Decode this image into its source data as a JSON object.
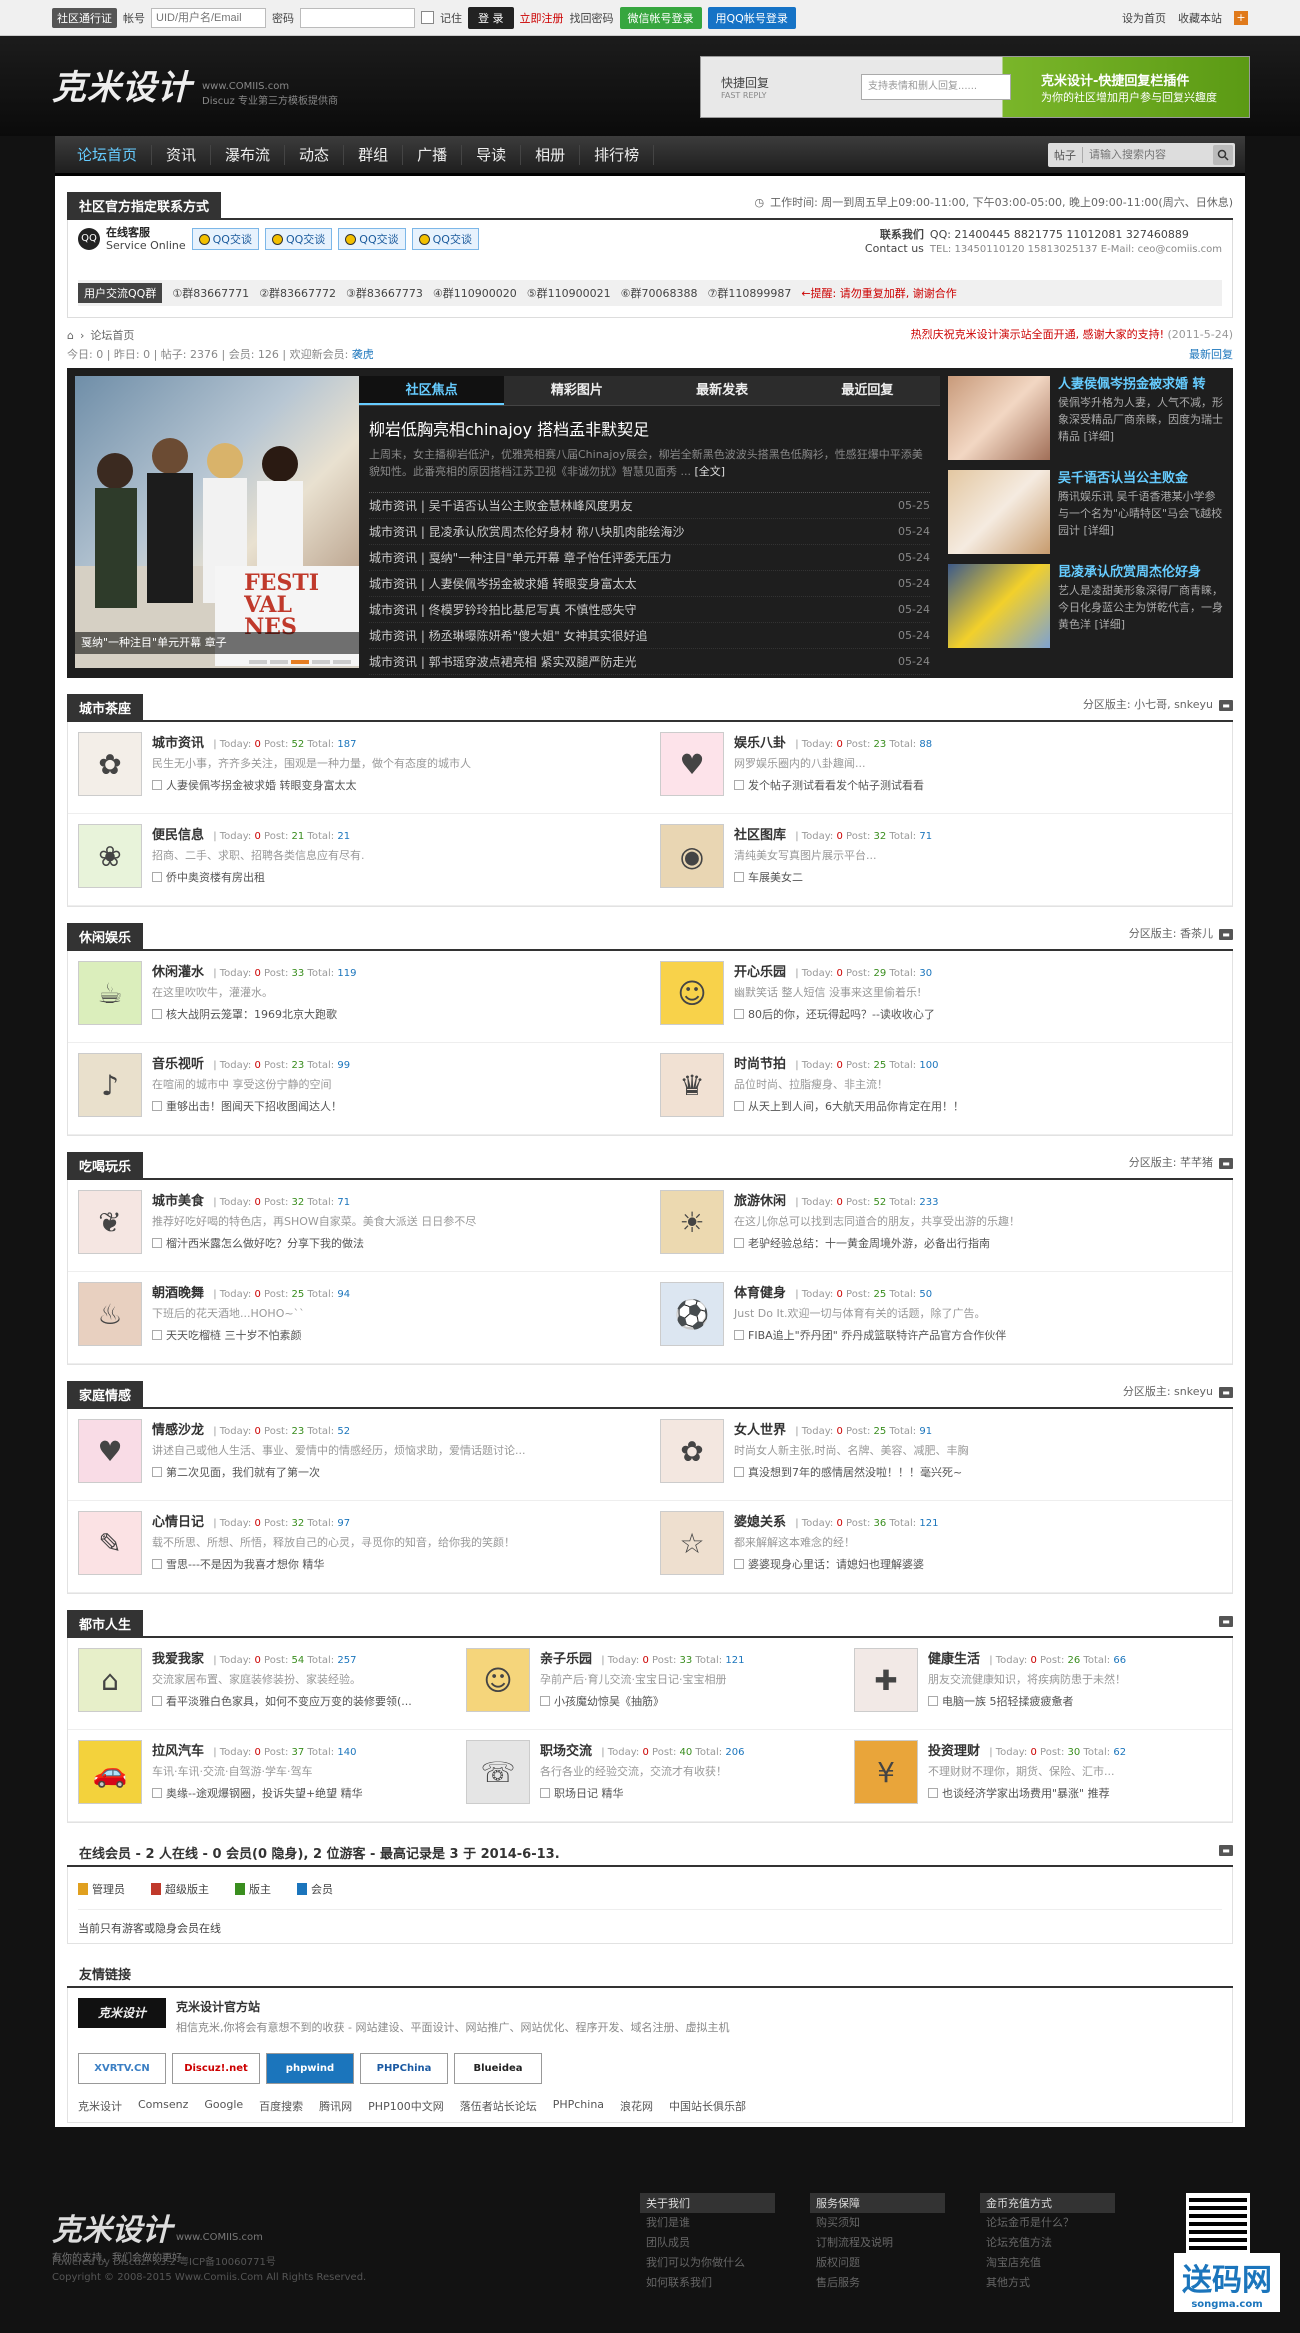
{
  "topbar": {
    "tag": "社区通行证",
    "account_label": "帐号",
    "account_placeholder": "UID/用户名/Email",
    "password_label": "密码",
    "remember": "记住",
    "login": "登 录",
    "register": "立即注册",
    "find_pw": "找回密码",
    "wechat_login": "微信帐号登录",
    "qq_login": "用QQ帐号登录",
    "homepage": "设为首页",
    "favorite": "收藏本站"
  },
  "header": {
    "logo": "克米设计",
    "domain": "www.COMIIS.com",
    "slogan": "Discuz 专业第三方模板提供商",
    "ad_fast": "快捷回复",
    "ad_fast_en": "FAST REPLY",
    "ad_input": "支持表情和删人回复......",
    "ad_title": "克米设计-快捷回复栏插件",
    "ad_sub": "为你的社区增加用户参与回复兴趣度"
  },
  "nav": {
    "items": [
      "论坛首页",
      "资讯",
      "瀑布流",
      "动态",
      "群组",
      "广播",
      "导读",
      "相册",
      "排行榜"
    ],
    "search_type": "帖子",
    "search_placeholder": "请输入搜索内容"
  },
  "contact": {
    "title": "社区官方指定联系方式",
    "work_time": "工作时间: 周一到周五早上09:00-11:00, 下午03:00-05:00, 晚上09:00-11:00(周六、日休息)",
    "kefu_title": "在线客服",
    "kefu_en": "Service Online",
    "qq_buttons": [
      "QQ交谈",
      "QQ交谈",
      "QQ交谈",
      "QQ交谈"
    ],
    "contact_us": "联系我们",
    "contact_us_en": "Contact us",
    "qq_numbers": "QQ: 21400445  8821775  11012081  327460889",
    "tel": "TEL: 13450110120  15813025137  E-Mail: ceo@comiis.com",
    "groups_label": "用户交流QQ群",
    "groups": [
      "①群83667771",
      "②群83667772",
      "③群83667773",
      "④群110900020",
      "⑤群110900021",
      "⑥群70068388",
      "⑦群110899987"
    ],
    "alert": "←提醒: 请勿重复加群, 谢谢合作"
  },
  "crumbs": {
    "current": "论坛首页",
    "notice": "热烈庆祝克米设计演示站全面开通, 感谢大家的支持!",
    "notice_date": "(2011-5-24)"
  },
  "stats": {
    "text": "今日: 0  |  昨日: 0  |  帖子: 2376  |  会员: 126  |  欢迎新会员: ",
    "new_member": "袭虎",
    "latest": "最新回复"
  },
  "focus": {
    "tabs": [
      "社区焦点",
      "精彩图片",
      "最新发表",
      "最近回复"
    ],
    "caption": "戛纳\"一种注目\"单元开幕 章子",
    "fest": "FESTI\nVAL\nNES",
    "headline": "柳岩低胸亮相chinajoy 搭档孟非默契足",
    "summary": "上周末，女主播柳岩低沪，优雅亮相赛八届Chinajoy展会，柳岩全新黑色波波头搭黑色低胸衫，性感狂爆中平添美貌知性。此番亮相的原因搭档江苏卫视《非诚勿扰》智慧见面秀 ...",
    "full": "[全文]",
    "list": [
      {
        "t": "城市资讯 | 吴千语否认当公主败金慧林峰风度男友",
        "d": "05-25"
      },
      {
        "t": "城市资讯 | 昆凌承认欣赏周杰伦好身材 称八块肌肉能绘海沙",
        "d": "05-24"
      },
      {
        "t": "城市资讯 | 戛纳\"一种注目\"单元开幕 章子怡任评委无压力",
        "d": "05-24"
      },
      {
        "t": "城市资讯 | 人妻侯佩岑拐金被求婚 转眼变身富太太",
        "d": "05-24"
      },
      {
        "t": "城市资讯 | 佟模罗钤玲拍比基尼写真 不慎性感失守",
        "d": "05-24"
      },
      {
        "t": "城市资讯 | 杨丞琳曝陈妍希\"傻大姐\" 女神其实很好追",
        "d": "05-24"
      },
      {
        "t": "城市资讯 | 郭书瑶穿波点裙亮相 紧实双腿严防走光",
        "d": "05-24"
      }
    ],
    "side": [
      {
        "t": "人妻侯佩岑拐金被求婚 转",
        "d": "侯佩岑升格为人妻，人气不减，形象深受精品厂商亲睐，因度为瑞士精品 [详细]"
      },
      {
        "t": "吴千语否认当公主败金",
        "d": "腾讯娱乐讯 吴千语香港某小学参与一个名为\"心晴特区\"马会飞越校园计 [详细]"
      },
      {
        "t": "昆凌承认欣赏周杰伦好身",
        "d": "艺人是凌甜美形象深得厂商青睐，今日化身蓝公主为饼乾代言，一身黄色洋 [详细]"
      }
    ]
  },
  "sections": [
    {
      "title": "城市茶座",
      "mods": "分区版主: 小七哥, snkeyu",
      "cols": 2,
      "forums": [
        {
          "name": "城市资讯",
          "today": "0",
          "post": "52",
          "total": "187",
          "desc": "民生无小事，齐齐多关注，围观是一种力量，做个有态度的城市人",
          "last": "人妻侯佩岑拐金被求婚 转眼变身富太太",
          "icon": "✿",
          "bg": "#f3eee8"
        },
        {
          "name": "娱乐八卦",
          "today": "0",
          "post": "23",
          "total": "88",
          "desc": "网罗娱乐圈内的八卦趣闻...",
          "last": "发个帖子测试看看发个帖子测试看看",
          "icon": "♥",
          "bg": "#fde3ea"
        },
        {
          "name": "便民信息",
          "today": "0",
          "post": "21",
          "total": "21",
          "desc": "招商、二手、求职、招聘各类信息应有尽有.",
          "last": "侨中奥资楼有房出租",
          "icon": "❀",
          "bg": "#e8f3da"
        },
        {
          "name": "社区图库",
          "today": "0",
          "post": "32",
          "total": "71",
          "desc": "清纯美女写真图片展示平台...",
          "last": "车展美女二",
          "icon": "◉",
          "bg": "#e9d6b3"
        }
      ]
    },
    {
      "title": "休闲娱乐",
      "mods": "分区版主: 香茶儿",
      "cols": 2,
      "forums": [
        {
          "name": "休闲灌水",
          "today": "0",
          "post": "33",
          "total": "119",
          "desc": "在这里吹吹牛，灌灌水。",
          "last": "核大战阴云笼罩：1969北京大跑歌",
          "icon": "☕",
          "bg": "#dbeebc"
        },
        {
          "name": "开心乐园",
          "today": "0",
          "post": "29",
          "total": "30",
          "desc": "幽默笑话 整人短信 没事来这里偷着乐!",
          "last": "80后的你，还玩得起吗？--读收收心了",
          "icon": "☺",
          "bg": "#f8d24a"
        },
        {
          "name": "音乐视听",
          "today": "0",
          "post": "23",
          "total": "99",
          "desc": "在喧闹的城市中 享受这份宁静的空间",
          "last": "重够出击！图闻天下招收图闻达人！",
          "icon": "♪",
          "bg": "#e9e0cc"
        },
        {
          "name": "时尚节拍",
          "today": "0",
          "post": "25",
          "total": "100",
          "desc": "品位时尚、拉脂瘦身、非主流！",
          "last": "从天上到人间，6大航天用品你肯定在用！！",
          "icon": "♛",
          "bg": "#f1e1d3"
        }
      ]
    },
    {
      "title": "吃喝玩乐",
      "mods": "分区版主: 芊芊猪",
      "cols": 2,
      "forums": [
        {
          "name": "城市美食",
          "today": "0",
          "post": "32",
          "total": "71",
          "desc": "推荐好吃好喝的特色店，再SHOW自家菜。美食大派送 日日参不尽",
          "last": "榴汁西米露怎么做好吃？分享下我的做法",
          "icon": "❦",
          "bg": "#f5e6e2"
        },
        {
          "name": "旅游休闲",
          "today": "0",
          "post": "52",
          "total": "233",
          "desc": "在这儿你总可以找到志同道合的朋友，共享受出游的乐趣！",
          "last": "老驴经验总结：十一黄金周境外游，必备出行指南",
          "icon": "☀",
          "bg": "#ecd9b0"
        },
        {
          "name": "朝酒晚舞",
          "today": "0",
          "post": "25",
          "total": "94",
          "desc": "下班后的花天酒地...HOHO~``",
          "last": "天天吃榴梿 三十岁不怕素颜",
          "icon": "♨",
          "bg": "#e8d0c0"
        },
        {
          "name": "体育健身",
          "today": "0",
          "post": "25",
          "total": "50",
          "desc": "Just Do It.欢迎一切与体育有关的话题，除了广告。",
          "last": "FIBA追上\"乔丹团\" 乔丹成篮联特许产品官方合作伙伴",
          "icon": "⚽",
          "bg": "#dce6f1"
        }
      ]
    },
    {
      "title": "家庭情感",
      "mods": "分区版主: snkeyu",
      "cols": 2,
      "forums": [
        {
          "name": "情感沙龙",
          "today": "0",
          "post": "23",
          "total": "52",
          "desc": "讲述自己或他人生活、事业、爱情中的情感经历，烦恼求助，爱情话题讨论...",
          "last": "第二次见面，我们就有了第一次",
          "icon": "♥",
          "bg": "#f9dce6"
        },
        {
          "name": "女人世界",
          "today": "0",
          "post": "25",
          "total": "91",
          "desc": "时尚女人新主张,时尚、名牌、美容、减肥、丰胸",
          "last": "真没想到7年的感情居然没啦！！！毫兴死~",
          "icon": "✿",
          "bg": "#f3e7e0"
        },
        {
          "name": "心情日记",
          "today": "0",
          "post": "32",
          "total": "97",
          "desc": "载不所思、所想、所悟，释放自己的心灵，寻觅你的知音，给你我的笑颜！",
          "last": "雪思---不是因为我喜才想你 精华",
          "icon": "✎",
          "bg": "#fbe2e4"
        },
        {
          "name": "婆媳关系",
          "today": "0",
          "post": "36",
          "total": "121",
          "desc": "都来解解这本难念的经！",
          "last": "婆婆现身心里话：请媳妇也理解婆婆",
          "icon": "☆",
          "bg": "#eedfcf"
        }
      ]
    },
    {
      "title": "都市人生",
      "mods": "",
      "cols": 3,
      "forums": [
        {
          "name": "我爱我家",
          "today": "0",
          "post": "54",
          "total": "257",
          "desc": "交流家居布置、家庭装修装扮、家装经验。",
          "last": "看平淡雅白色家具，如何不变应万变的装修要领(...",
          "icon": "⌂",
          "bg": "#e7efc9"
        },
        {
          "name": "亲子乐园",
          "today": "0",
          "post": "33",
          "total": "121",
          "desc": "孕前产后·育儿交流·宝宝日记·宝宝相册",
          "last": "小孩魔幼惊吴《抽筋》",
          "icon": "☺",
          "bg": "#f5d57b"
        },
        {
          "name": "健康生活",
          "today": "0",
          "post": "26",
          "total": "66",
          "desc": "朋友交流健康知识，将疾病防患于未然！",
          "last": "电脑一族 5招轻揉疲疲惫者",
          "icon": "✚",
          "bg": "#f2e9e6"
        },
        {
          "name": "拉风汽车",
          "today": "0",
          "post": "37",
          "total": "140",
          "desc": "车讯·车讯·交流·自驾游·学车·驾车",
          "last": "奥缘--途观爆钢圈，投诉失望+绝望 精华",
          "icon": "🚗",
          "bg": "#f3d23c"
        },
        {
          "name": "职场交流",
          "today": "0",
          "post": "40",
          "total": "206",
          "desc": "各行各业的经验交流，交流才有收获！",
          "last": "职场日记 精华",
          "icon": "☏",
          "bg": "#e5e5e5"
        },
        {
          "name": "投资理财",
          "today": "0",
          "post": "30",
          "total": "62",
          "desc": "不理财财不理你，期货、保险、汇市...",
          "last": "也谈经济学家出场费用\"暴涨\" 推荐",
          "icon": "¥",
          "bg": "#e9a53a"
        }
      ]
    }
  ],
  "online": {
    "title": "在线会员 - 2 人在线 - 0 会员(0 隐身), 2 位游客 - 最高记录是 3 于 2014-6-13.",
    "legend": [
      "管理员",
      "超级版主",
      "版主",
      "会员"
    ],
    "note": "当前只有游客或隐身会员在线"
  },
  "links": {
    "title": "友情链接",
    "site_name": "克米设计官方站",
    "site_logo": "克米设计",
    "site_desc": "相信克米,你将会有意想不到的收获 - 网站建设、平面设计、网站推广、网站优化、程序开发、域名注册、虚拟主机",
    "badges": [
      "XVRTV.CN",
      "Discuz!.net",
      "phpwind",
      "PHPChina",
      "Blueidea"
    ],
    "text_links": [
      "克米设计",
      "Comsenz",
      "Google",
      "百度搜索",
      "腾讯网",
      "PHP100中文网",
      "落伍者站长论坛",
      "PHPchina",
      "浪花网",
      "中国站长俱乐部"
    ]
  },
  "footer": {
    "logo": "克米设计",
    "domain": "www.COMIIS.com",
    "tagline": "有你的支持，我们会做的更好",
    "powered": "Powered by Discuz! X3.2  粤ICP备10060771号",
    "copyright": "Copyright © 2008-2015 Www.Comiis.Com All Rights Reserved.",
    "cols": [
      {
        "title": "关于我们",
        "items": [
          "我们是谁",
          "团队成员",
          "我们可以为你做什么",
          "如何联系我们"
        ]
      },
      {
        "title": "服务保障",
        "items": [
          "购买须知",
          "订制流程及说明",
          "版权问题",
          "售后服务"
        ]
      },
      {
        "title": "金币充值方式",
        "items": [
          "论坛金币是什么？",
          "论坛充值方法",
          "淘宝店充值",
          "其他方式"
        ]
      }
    ],
    "watermark": "送码网",
    "watermark_sub": "songma.com"
  }
}
